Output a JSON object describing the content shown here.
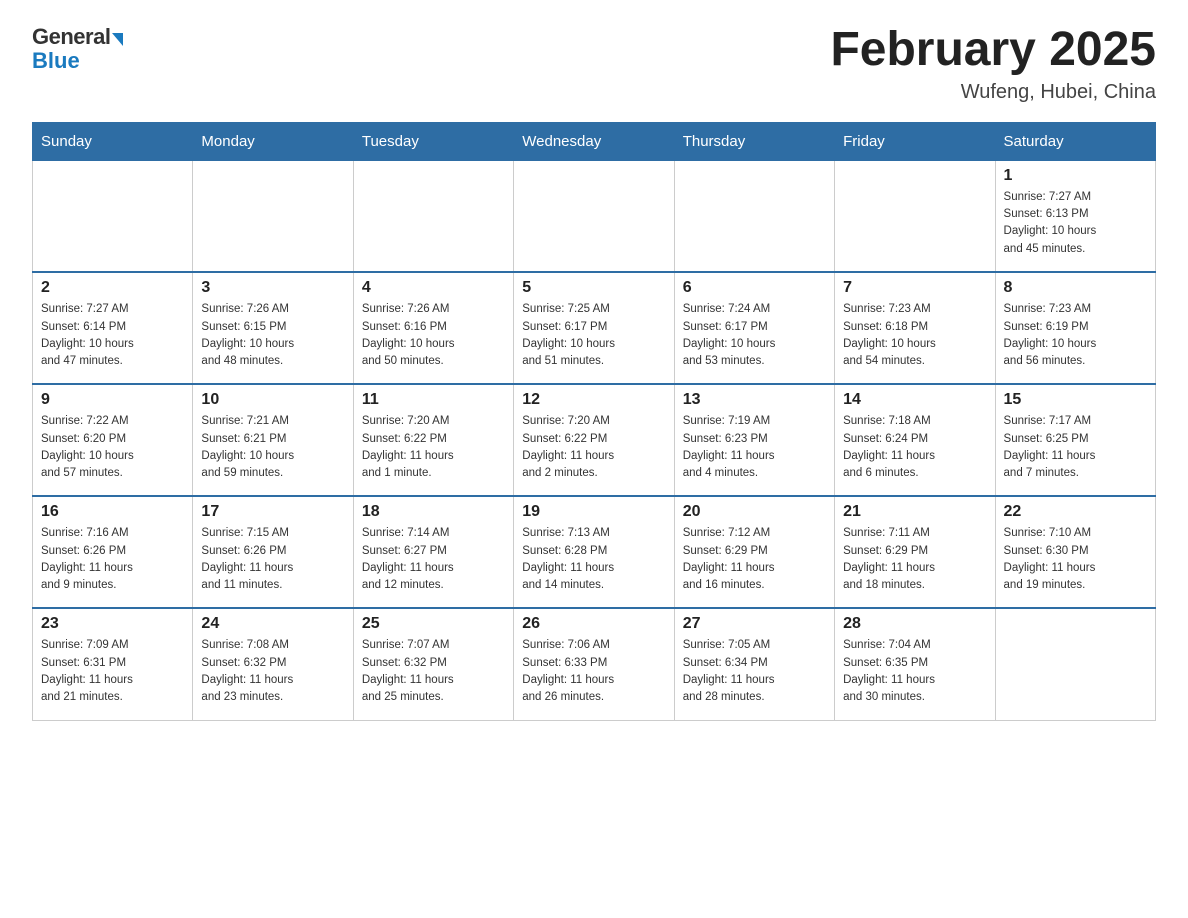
{
  "header": {
    "logo_general": "General",
    "logo_blue": "Blue",
    "month_title": "February 2025",
    "location": "Wufeng, Hubei, China"
  },
  "days_of_week": [
    "Sunday",
    "Monday",
    "Tuesday",
    "Wednesday",
    "Thursday",
    "Friday",
    "Saturday"
  ],
  "weeks": [
    [
      {
        "day": "",
        "info": ""
      },
      {
        "day": "",
        "info": ""
      },
      {
        "day": "",
        "info": ""
      },
      {
        "day": "",
        "info": ""
      },
      {
        "day": "",
        "info": ""
      },
      {
        "day": "",
        "info": ""
      },
      {
        "day": "1",
        "info": "Sunrise: 7:27 AM\nSunset: 6:13 PM\nDaylight: 10 hours\nand 45 minutes."
      }
    ],
    [
      {
        "day": "2",
        "info": "Sunrise: 7:27 AM\nSunset: 6:14 PM\nDaylight: 10 hours\nand 47 minutes."
      },
      {
        "day": "3",
        "info": "Sunrise: 7:26 AM\nSunset: 6:15 PM\nDaylight: 10 hours\nand 48 minutes."
      },
      {
        "day": "4",
        "info": "Sunrise: 7:26 AM\nSunset: 6:16 PM\nDaylight: 10 hours\nand 50 minutes."
      },
      {
        "day": "5",
        "info": "Sunrise: 7:25 AM\nSunset: 6:17 PM\nDaylight: 10 hours\nand 51 minutes."
      },
      {
        "day": "6",
        "info": "Sunrise: 7:24 AM\nSunset: 6:17 PM\nDaylight: 10 hours\nand 53 minutes."
      },
      {
        "day": "7",
        "info": "Sunrise: 7:23 AM\nSunset: 6:18 PM\nDaylight: 10 hours\nand 54 minutes."
      },
      {
        "day": "8",
        "info": "Sunrise: 7:23 AM\nSunset: 6:19 PM\nDaylight: 10 hours\nand 56 minutes."
      }
    ],
    [
      {
        "day": "9",
        "info": "Sunrise: 7:22 AM\nSunset: 6:20 PM\nDaylight: 10 hours\nand 57 minutes."
      },
      {
        "day": "10",
        "info": "Sunrise: 7:21 AM\nSunset: 6:21 PM\nDaylight: 10 hours\nand 59 minutes."
      },
      {
        "day": "11",
        "info": "Sunrise: 7:20 AM\nSunset: 6:22 PM\nDaylight: 11 hours\nand 1 minute."
      },
      {
        "day": "12",
        "info": "Sunrise: 7:20 AM\nSunset: 6:22 PM\nDaylight: 11 hours\nand 2 minutes."
      },
      {
        "day": "13",
        "info": "Sunrise: 7:19 AM\nSunset: 6:23 PM\nDaylight: 11 hours\nand 4 minutes."
      },
      {
        "day": "14",
        "info": "Sunrise: 7:18 AM\nSunset: 6:24 PM\nDaylight: 11 hours\nand 6 minutes."
      },
      {
        "day": "15",
        "info": "Sunrise: 7:17 AM\nSunset: 6:25 PM\nDaylight: 11 hours\nand 7 minutes."
      }
    ],
    [
      {
        "day": "16",
        "info": "Sunrise: 7:16 AM\nSunset: 6:26 PM\nDaylight: 11 hours\nand 9 minutes."
      },
      {
        "day": "17",
        "info": "Sunrise: 7:15 AM\nSunset: 6:26 PM\nDaylight: 11 hours\nand 11 minutes."
      },
      {
        "day": "18",
        "info": "Sunrise: 7:14 AM\nSunset: 6:27 PM\nDaylight: 11 hours\nand 12 minutes."
      },
      {
        "day": "19",
        "info": "Sunrise: 7:13 AM\nSunset: 6:28 PM\nDaylight: 11 hours\nand 14 minutes."
      },
      {
        "day": "20",
        "info": "Sunrise: 7:12 AM\nSunset: 6:29 PM\nDaylight: 11 hours\nand 16 minutes."
      },
      {
        "day": "21",
        "info": "Sunrise: 7:11 AM\nSunset: 6:29 PM\nDaylight: 11 hours\nand 18 minutes."
      },
      {
        "day": "22",
        "info": "Sunrise: 7:10 AM\nSunset: 6:30 PM\nDaylight: 11 hours\nand 19 minutes."
      }
    ],
    [
      {
        "day": "23",
        "info": "Sunrise: 7:09 AM\nSunset: 6:31 PM\nDaylight: 11 hours\nand 21 minutes."
      },
      {
        "day": "24",
        "info": "Sunrise: 7:08 AM\nSunset: 6:32 PM\nDaylight: 11 hours\nand 23 minutes."
      },
      {
        "day": "25",
        "info": "Sunrise: 7:07 AM\nSunset: 6:32 PM\nDaylight: 11 hours\nand 25 minutes."
      },
      {
        "day": "26",
        "info": "Sunrise: 7:06 AM\nSunset: 6:33 PM\nDaylight: 11 hours\nand 26 minutes."
      },
      {
        "day": "27",
        "info": "Sunrise: 7:05 AM\nSunset: 6:34 PM\nDaylight: 11 hours\nand 28 minutes."
      },
      {
        "day": "28",
        "info": "Sunrise: 7:04 AM\nSunset: 6:35 PM\nDaylight: 11 hours\nand 30 minutes."
      },
      {
        "day": "",
        "info": ""
      }
    ]
  ]
}
